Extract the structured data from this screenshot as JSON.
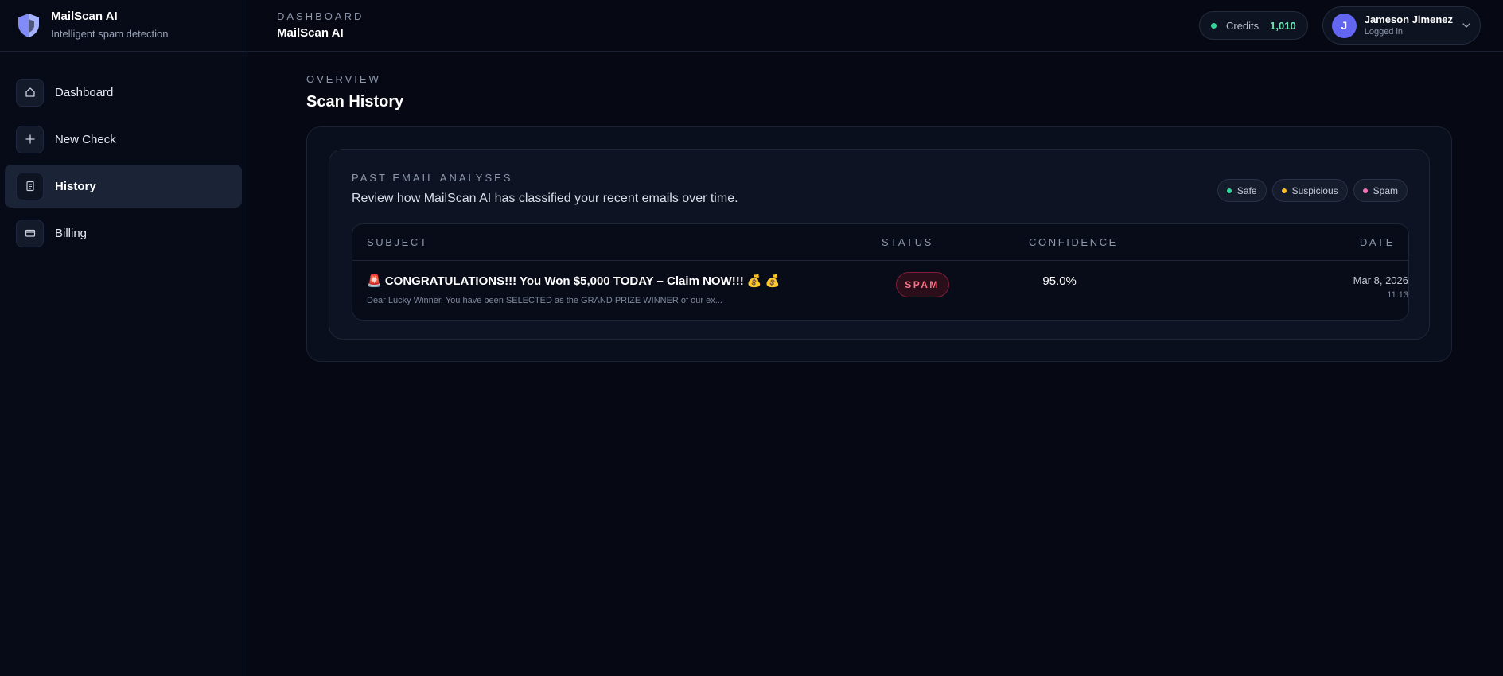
{
  "brand": {
    "name": "MailScan AI",
    "tagline": "Intelligent spam detection",
    "accent": "#818cf8"
  },
  "sidebar": {
    "items": [
      {
        "label": "Dashboard",
        "icon": "home-icon",
        "active": false
      },
      {
        "label": "New Check",
        "icon": "plus-icon",
        "active": false
      },
      {
        "label": "History",
        "icon": "document-icon",
        "active": true
      },
      {
        "label": "Billing",
        "icon": "card-icon",
        "active": false
      }
    ]
  },
  "header": {
    "breadcrumb": "DASHBOARD",
    "title": "MailScan AI",
    "credits_label": "Credits",
    "credits_value": "1,010",
    "user": {
      "initial": "J",
      "name": "Jameson Jimenez",
      "status": "Logged in"
    }
  },
  "page": {
    "kicker": "OVERVIEW",
    "title": "Scan History"
  },
  "history": {
    "kicker": "PAST EMAIL ANALYSES",
    "description": "Review how MailScan AI has classified your recent emails over time.",
    "legend": [
      {
        "label": "Safe",
        "color": "#34d399"
      },
      {
        "label": "Suspicious",
        "color": "#fbbf24"
      },
      {
        "label": "Spam",
        "color": "#f472b6"
      }
    ],
    "columns": {
      "subject": "SUBJECT",
      "status": "STATUS",
      "confidence": "CONFIDENCE",
      "date": "DATE"
    },
    "rows": [
      {
        "subject": "🚨 CONGRATULATIONS!!! You Won $5,000 TODAY – Claim NOW!!! 💰 💰",
        "preview": "Dear Lucky Winner, You have been SELECTED as the GRAND PRIZE WINNER of our ex...",
        "status": "SPAM",
        "confidence": "95.0%",
        "date": "Mar 8, 2026",
        "time": "11:13"
      }
    ]
  }
}
